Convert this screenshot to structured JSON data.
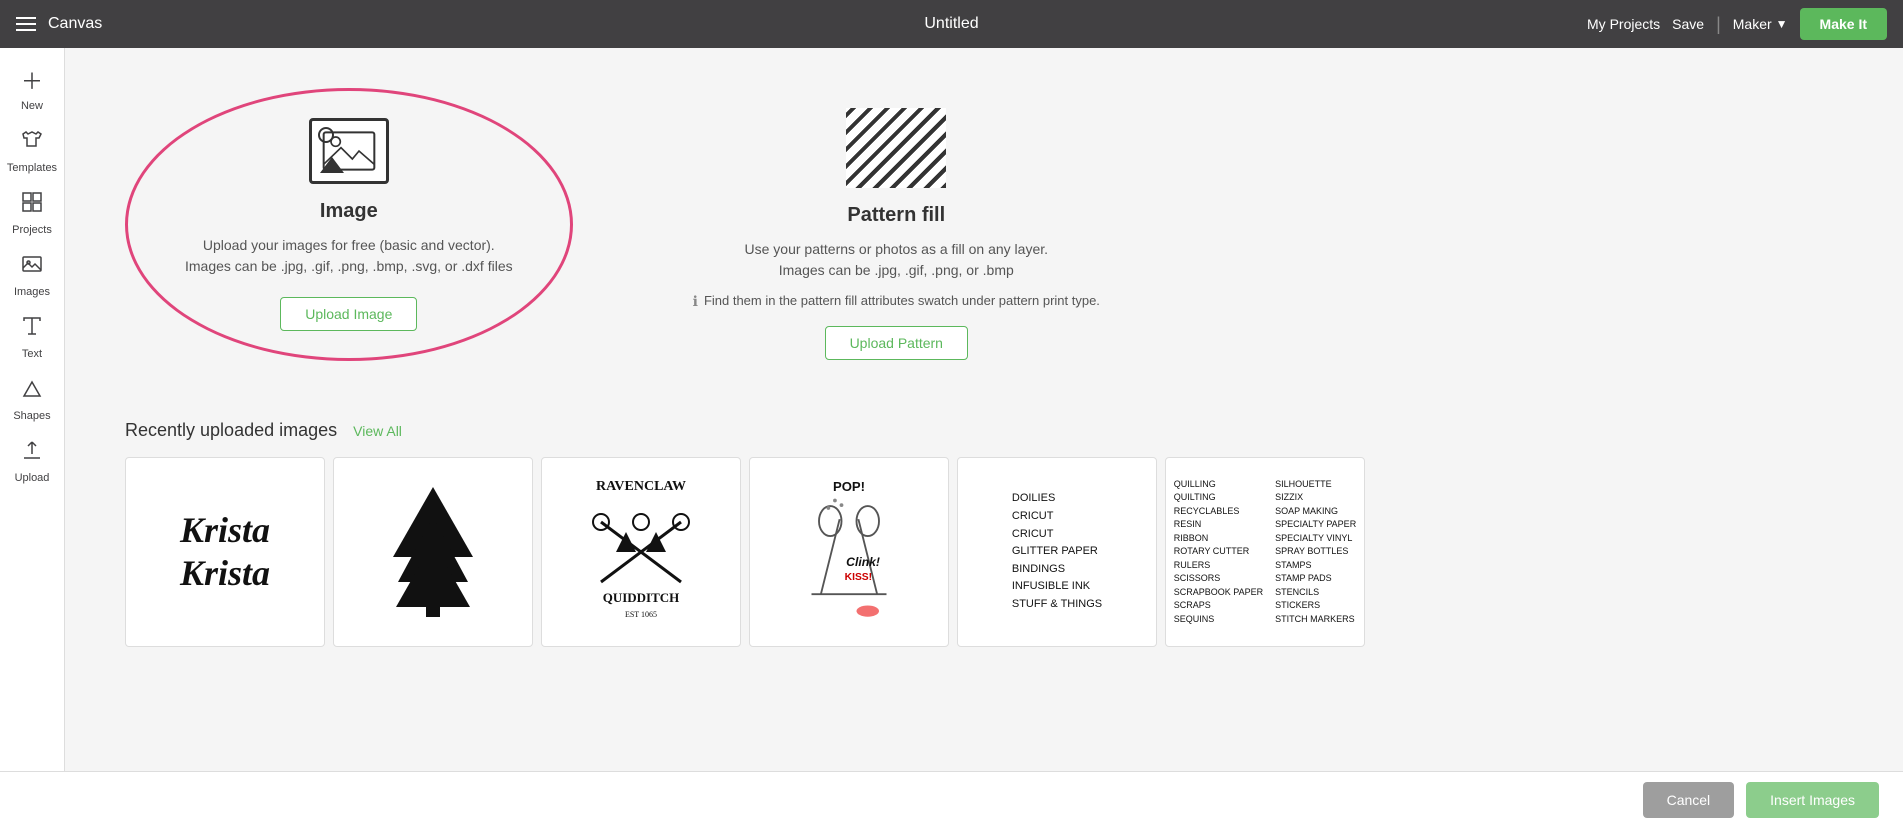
{
  "topbar": {
    "menu_icon": "hamburger-icon",
    "app_title": "Canvas",
    "doc_title": "Untitled",
    "my_projects_label": "My Projects",
    "save_label": "Save",
    "maker_label": "Maker",
    "make_it_label": "Make It"
  },
  "sidebar": {
    "items": [
      {
        "id": "new",
        "label": "New",
        "icon": "plus-icon"
      },
      {
        "id": "templates",
        "label": "Templates",
        "icon": "shirt-icon"
      },
      {
        "id": "projects",
        "label": "Projects",
        "icon": "grid-icon"
      },
      {
        "id": "images",
        "label": "Images",
        "icon": "image-icon"
      },
      {
        "id": "text",
        "label": "Text",
        "icon": "text-icon"
      },
      {
        "id": "shapes",
        "label": "Shapes",
        "icon": "shapes-icon"
      },
      {
        "id": "upload",
        "label": "Upload",
        "icon": "upload-icon"
      }
    ]
  },
  "image_card": {
    "title": "Image",
    "desc_line1": "Upload your images for free (basic and vector).",
    "desc_line2": "Images can be .jpg, .gif, .png, .bmp, .svg, or .dxf files",
    "upload_btn_label": "Upload Image"
  },
  "pattern_card": {
    "title": "Pattern fill",
    "desc_line1": "Use your patterns or photos as a fill on any layer.",
    "desc_line2": "Images can be .jpg, .gif, .png, or .bmp",
    "info_text": "Find them in the pattern fill attributes swatch under pattern print type.",
    "upload_btn_label": "Upload Pattern"
  },
  "recently_uploaded": {
    "section_title": "Recently uploaded images",
    "view_all_label": "View All",
    "images": [
      {
        "id": 1,
        "type": "krista_text"
      },
      {
        "id": 2,
        "type": "tree"
      },
      {
        "id": 3,
        "type": "ravenclaw"
      },
      {
        "id": 4,
        "type": "pop"
      },
      {
        "id": 5,
        "type": "doilies"
      },
      {
        "id": 6,
        "type": "craft_list"
      }
    ]
  },
  "bottombar": {
    "cancel_label": "Cancel",
    "insert_label": "Insert Images"
  },
  "colors": {
    "accent_green": "#5cb85c",
    "accent_pink": "#e0457b",
    "topbar_bg": "#414042"
  }
}
